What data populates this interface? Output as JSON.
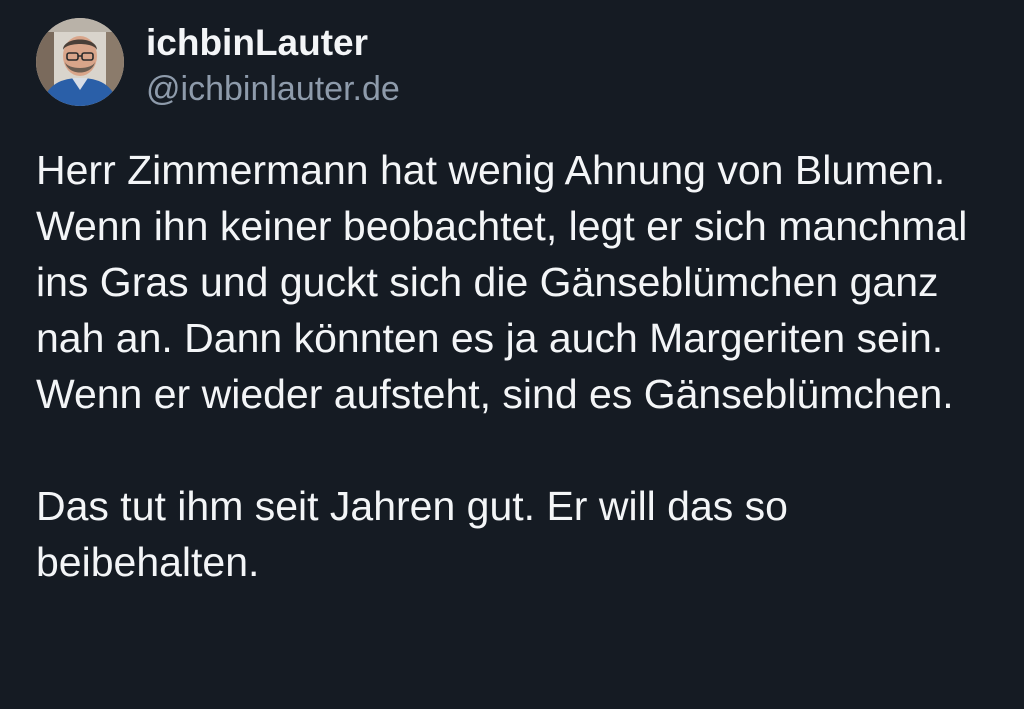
{
  "author": {
    "display_name": "ichbinLauter",
    "handle": "@ichbinlauter.de",
    "avatar_icon": "user-avatar-photo"
  },
  "post": {
    "paragraphs": [
      "Herr Zimmermann hat wenig Ahnung von Blumen. Wenn ihn keiner beobachtet, legt er sich manchmal ins Gras und guckt sich die Gänseblümchen ganz nah an. Dann könnten es ja auch Margeriten sein. Wenn er wieder aufsteht, sind es Gänseblümchen.",
      "Das tut ihm seit Jahren gut. Er will das so beibehalten."
    ]
  },
  "colors": {
    "background": "#151b23",
    "text_primary": "#f3f5f7",
    "text_secondary": "#8e9bab"
  }
}
